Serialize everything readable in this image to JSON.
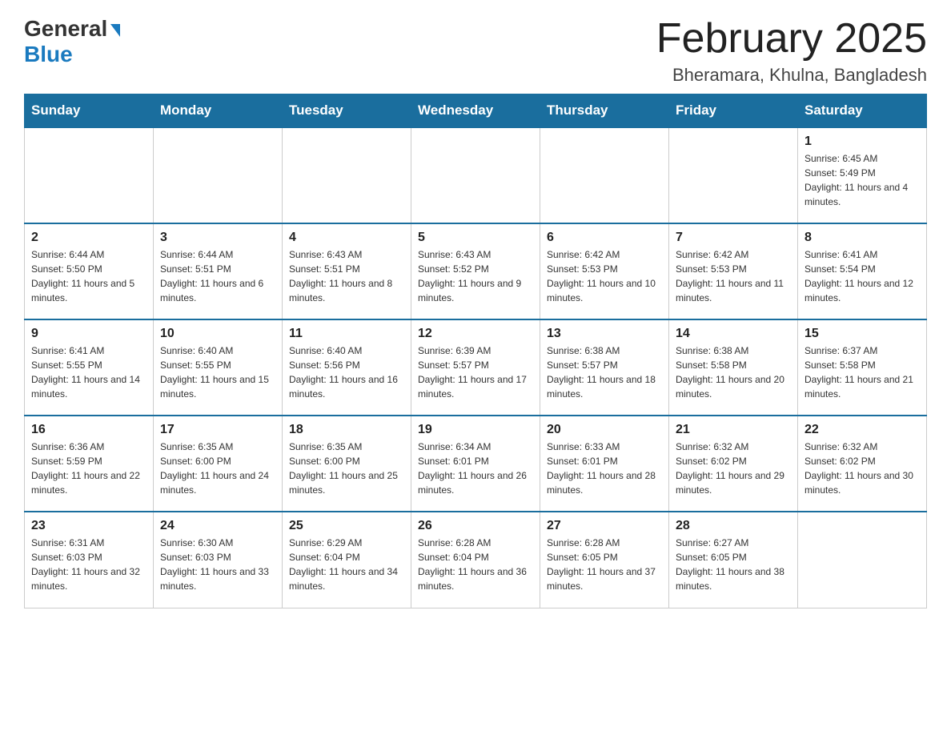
{
  "logo": {
    "general": "General",
    "blue": "Blue"
  },
  "title": "February 2025",
  "location": "Bheramara, Khulna, Bangladesh",
  "weekdays": [
    "Sunday",
    "Monday",
    "Tuesday",
    "Wednesday",
    "Thursday",
    "Friday",
    "Saturday"
  ],
  "weeks": [
    [
      {
        "day": "",
        "info": ""
      },
      {
        "day": "",
        "info": ""
      },
      {
        "day": "",
        "info": ""
      },
      {
        "day": "",
        "info": ""
      },
      {
        "day": "",
        "info": ""
      },
      {
        "day": "",
        "info": ""
      },
      {
        "day": "1",
        "info": "Sunrise: 6:45 AM\nSunset: 5:49 PM\nDaylight: 11 hours and 4 minutes."
      }
    ],
    [
      {
        "day": "2",
        "info": "Sunrise: 6:44 AM\nSunset: 5:50 PM\nDaylight: 11 hours and 5 minutes."
      },
      {
        "day": "3",
        "info": "Sunrise: 6:44 AM\nSunset: 5:51 PM\nDaylight: 11 hours and 6 minutes."
      },
      {
        "day": "4",
        "info": "Sunrise: 6:43 AM\nSunset: 5:51 PM\nDaylight: 11 hours and 8 minutes."
      },
      {
        "day": "5",
        "info": "Sunrise: 6:43 AM\nSunset: 5:52 PM\nDaylight: 11 hours and 9 minutes."
      },
      {
        "day": "6",
        "info": "Sunrise: 6:42 AM\nSunset: 5:53 PM\nDaylight: 11 hours and 10 minutes."
      },
      {
        "day": "7",
        "info": "Sunrise: 6:42 AM\nSunset: 5:53 PM\nDaylight: 11 hours and 11 minutes."
      },
      {
        "day": "8",
        "info": "Sunrise: 6:41 AM\nSunset: 5:54 PM\nDaylight: 11 hours and 12 minutes."
      }
    ],
    [
      {
        "day": "9",
        "info": "Sunrise: 6:41 AM\nSunset: 5:55 PM\nDaylight: 11 hours and 14 minutes."
      },
      {
        "day": "10",
        "info": "Sunrise: 6:40 AM\nSunset: 5:55 PM\nDaylight: 11 hours and 15 minutes."
      },
      {
        "day": "11",
        "info": "Sunrise: 6:40 AM\nSunset: 5:56 PM\nDaylight: 11 hours and 16 minutes."
      },
      {
        "day": "12",
        "info": "Sunrise: 6:39 AM\nSunset: 5:57 PM\nDaylight: 11 hours and 17 minutes."
      },
      {
        "day": "13",
        "info": "Sunrise: 6:38 AM\nSunset: 5:57 PM\nDaylight: 11 hours and 18 minutes."
      },
      {
        "day": "14",
        "info": "Sunrise: 6:38 AM\nSunset: 5:58 PM\nDaylight: 11 hours and 20 minutes."
      },
      {
        "day": "15",
        "info": "Sunrise: 6:37 AM\nSunset: 5:58 PM\nDaylight: 11 hours and 21 minutes."
      }
    ],
    [
      {
        "day": "16",
        "info": "Sunrise: 6:36 AM\nSunset: 5:59 PM\nDaylight: 11 hours and 22 minutes."
      },
      {
        "day": "17",
        "info": "Sunrise: 6:35 AM\nSunset: 6:00 PM\nDaylight: 11 hours and 24 minutes."
      },
      {
        "day": "18",
        "info": "Sunrise: 6:35 AM\nSunset: 6:00 PM\nDaylight: 11 hours and 25 minutes."
      },
      {
        "day": "19",
        "info": "Sunrise: 6:34 AM\nSunset: 6:01 PM\nDaylight: 11 hours and 26 minutes."
      },
      {
        "day": "20",
        "info": "Sunrise: 6:33 AM\nSunset: 6:01 PM\nDaylight: 11 hours and 28 minutes."
      },
      {
        "day": "21",
        "info": "Sunrise: 6:32 AM\nSunset: 6:02 PM\nDaylight: 11 hours and 29 minutes."
      },
      {
        "day": "22",
        "info": "Sunrise: 6:32 AM\nSunset: 6:02 PM\nDaylight: 11 hours and 30 minutes."
      }
    ],
    [
      {
        "day": "23",
        "info": "Sunrise: 6:31 AM\nSunset: 6:03 PM\nDaylight: 11 hours and 32 minutes."
      },
      {
        "day": "24",
        "info": "Sunrise: 6:30 AM\nSunset: 6:03 PM\nDaylight: 11 hours and 33 minutes."
      },
      {
        "day": "25",
        "info": "Sunrise: 6:29 AM\nSunset: 6:04 PM\nDaylight: 11 hours and 34 minutes."
      },
      {
        "day": "26",
        "info": "Sunrise: 6:28 AM\nSunset: 6:04 PM\nDaylight: 11 hours and 36 minutes."
      },
      {
        "day": "27",
        "info": "Sunrise: 6:28 AM\nSunset: 6:05 PM\nDaylight: 11 hours and 37 minutes."
      },
      {
        "day": "28",
        "info": "Sunrise: 6:27 AM\nSunset: 6:05 PM\nDaylight: 11 hours and 38 minutes."
      },
      {
        "day": "",
        "info": ""
      }
    ]
  ]
}
